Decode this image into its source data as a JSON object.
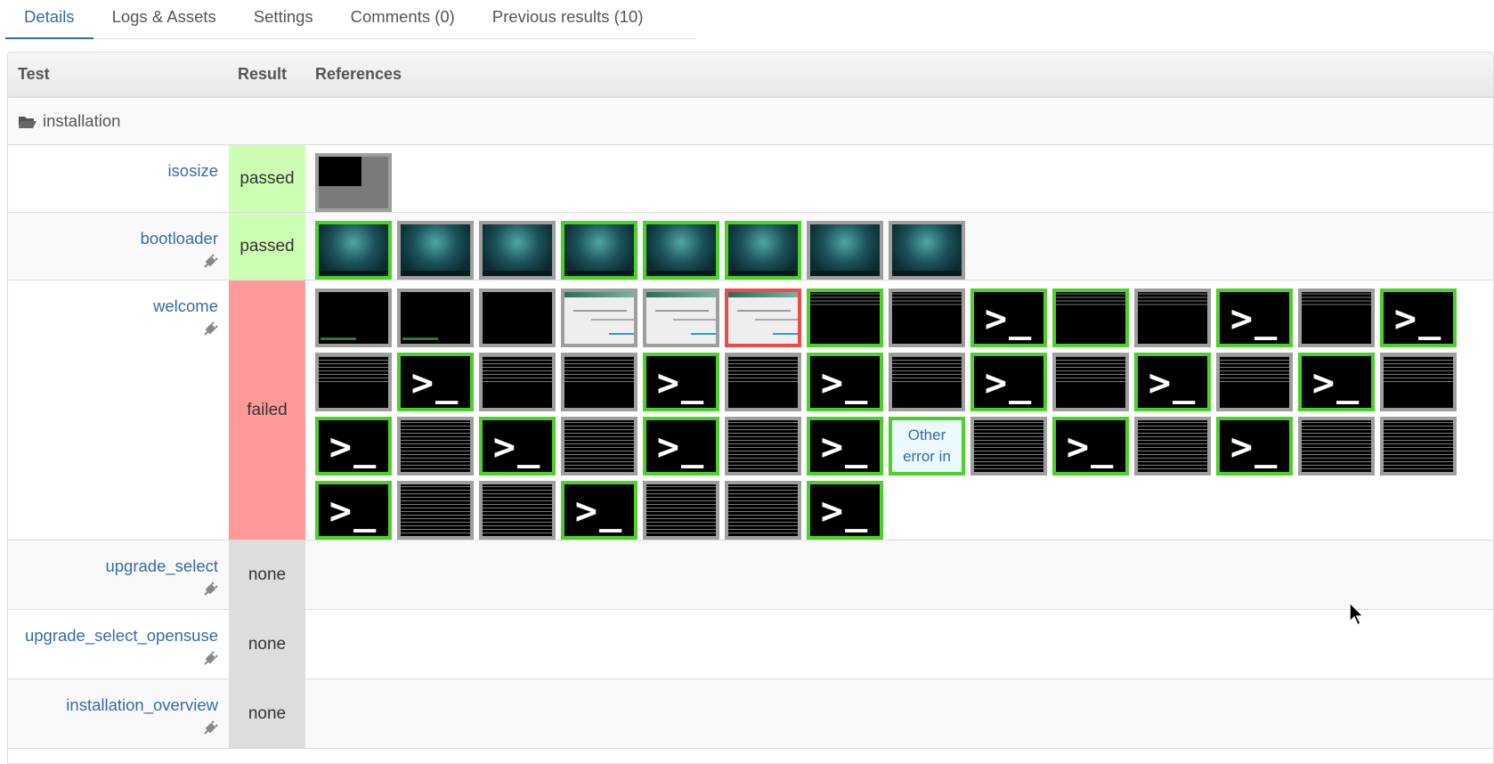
{
  "tabs": [
    {
      "label": "Details",
      "active": true
    },
    {
      "label": "Logs & Assets",
      "active": false
    },
    {
      "label": "Settings",
      "active": false
    },
    {
      "label": "Comments (0)",
      "active": false
    },
    {
      "label": "Previous results (10)",
      "active": false
    }
  ],
  "table": {
    "headers": {
      "test": "Test",
      "result": "Result",
      "refs": "References"
    },
    "category": "installation",
    "rows": [
      {
        "name": "isosize",
        "result": "passed",
        "has_plug": false
      },
      {
        "name": "bootloader",
        "result": "passed",
        "has_plug": true
      },
      {
        "name": "welcome",
        "result": "failed",
        "has_plug": true,
        "textbox": "Other error in"
      },
      {
        "name": "upgrade_select",
        "result": "none",
        "has_plug": true
      },
      {
        "name": "upgrade_select_opensuse",
        "result": "none",
        "has_plug": true
      },
      {
        "name": "installation_overview",
        "result": "none",
        "has_plug": true
      }
    ]
  },
  "colors": {
    "passed": "#ccffb3",
    "failed": "#ff9a99",
    "none": "#dddddd",
    "link": "#3a6aa5",
    "thumb_ok": "#4cd02a",
    "thumb_fail": "#ee4a4a"
  }
}
